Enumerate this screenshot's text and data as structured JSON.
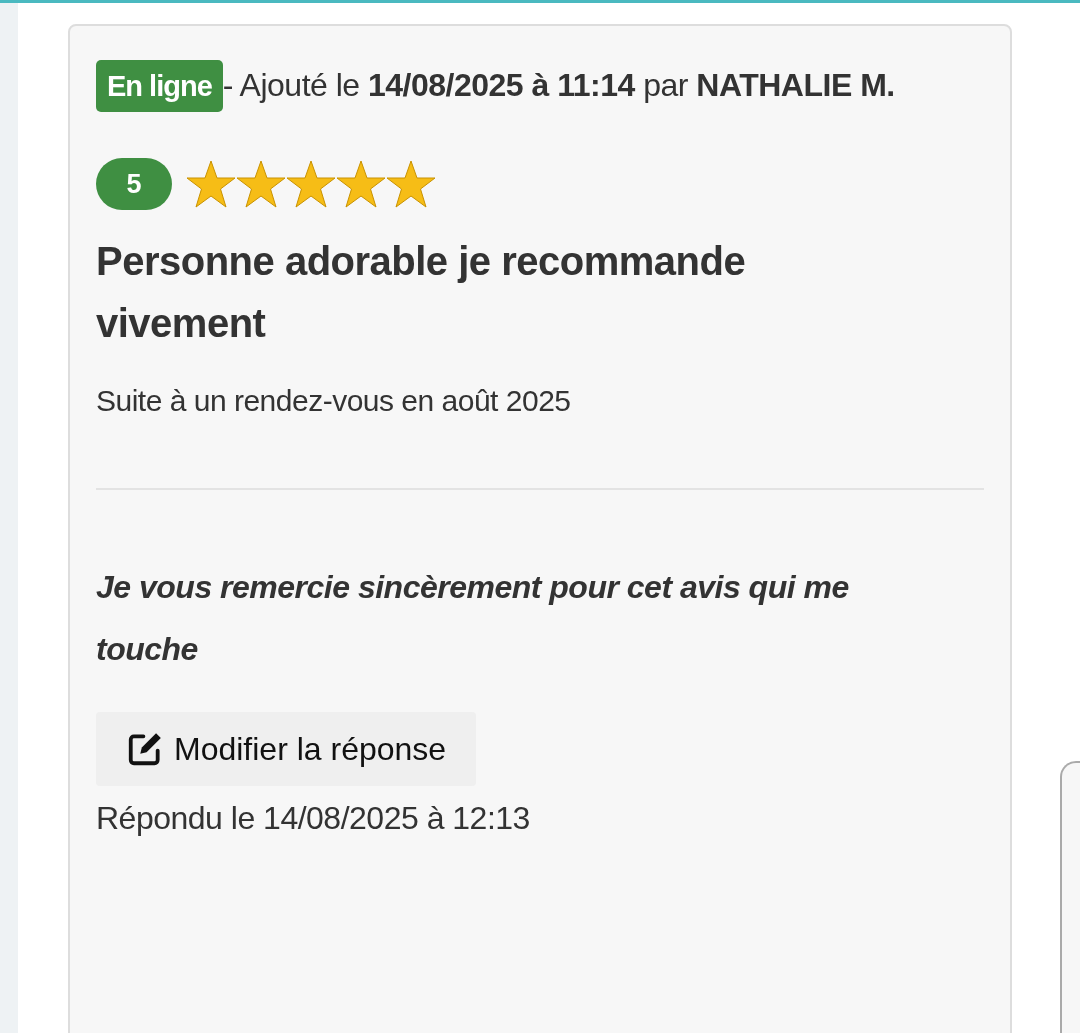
{
  "review": {
    "status": "En ligne",
    "meta": "- Ajouté le **14/08/2025 à 11:14** par **NATHALIE M.**",
    "rating": "5",
    "stars": 5,
    "title": "Personne adorable je recommande vivement",
    "context": "Suite à un rendez-vous en août 2025",
    "reply": "Je vous remercie sincèrement pour cet avis qui me touche",
    "edit_button": "Modifier la réponse",
    "replied": "Répondu le 14/08/2025 à 12:13"
  }
}
